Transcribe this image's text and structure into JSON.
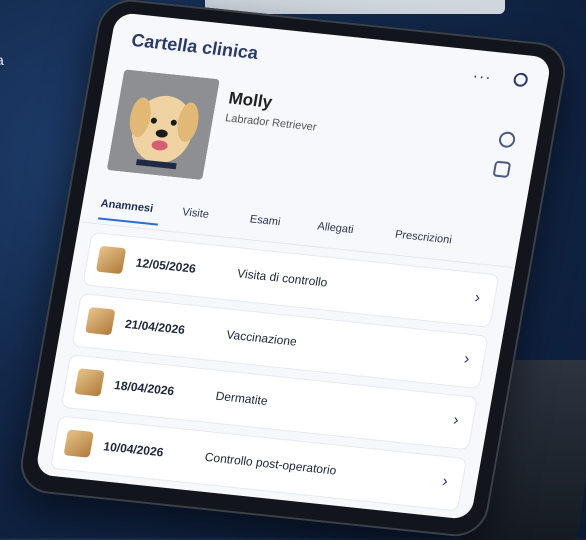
{
  "background": {
    "text_fragment": "a"
  },
  "app": {
    "title": "Cartella clinica",
    "menu_icon": "more-icon",
    "user_icon": "user-icon"
  },
  "pet": {
    "name": "Molly",
    "breed": "Labrador Retriever"
  },
  "tabs": [
    {
      "label": "Anamnesi",
      "active": true
    },
    {
      "label": "Visite"
    },
    {
      "label": "Esami"
    },
    {
      "label": "Allegati"
    },
    {
      "label": "Prescrizioni"
    }
  ],
  "records": [
    {
      "date": "12/05/2026",
      "description": "Visita di controllo"
    },
    {
      "date": "21/04/2026",
      "description": "Vaccinazione"
    },
    {
      "date": "18/04/2026",
      "description": "Dermatite"
    },
    {
      "date": "10/04/2026",
      "description": "Controllo post-operatorio"
    }
  ],
  "colors": {
    "accent": "#2e6ad1",
    "title": "#2b3a67"
  }
}
